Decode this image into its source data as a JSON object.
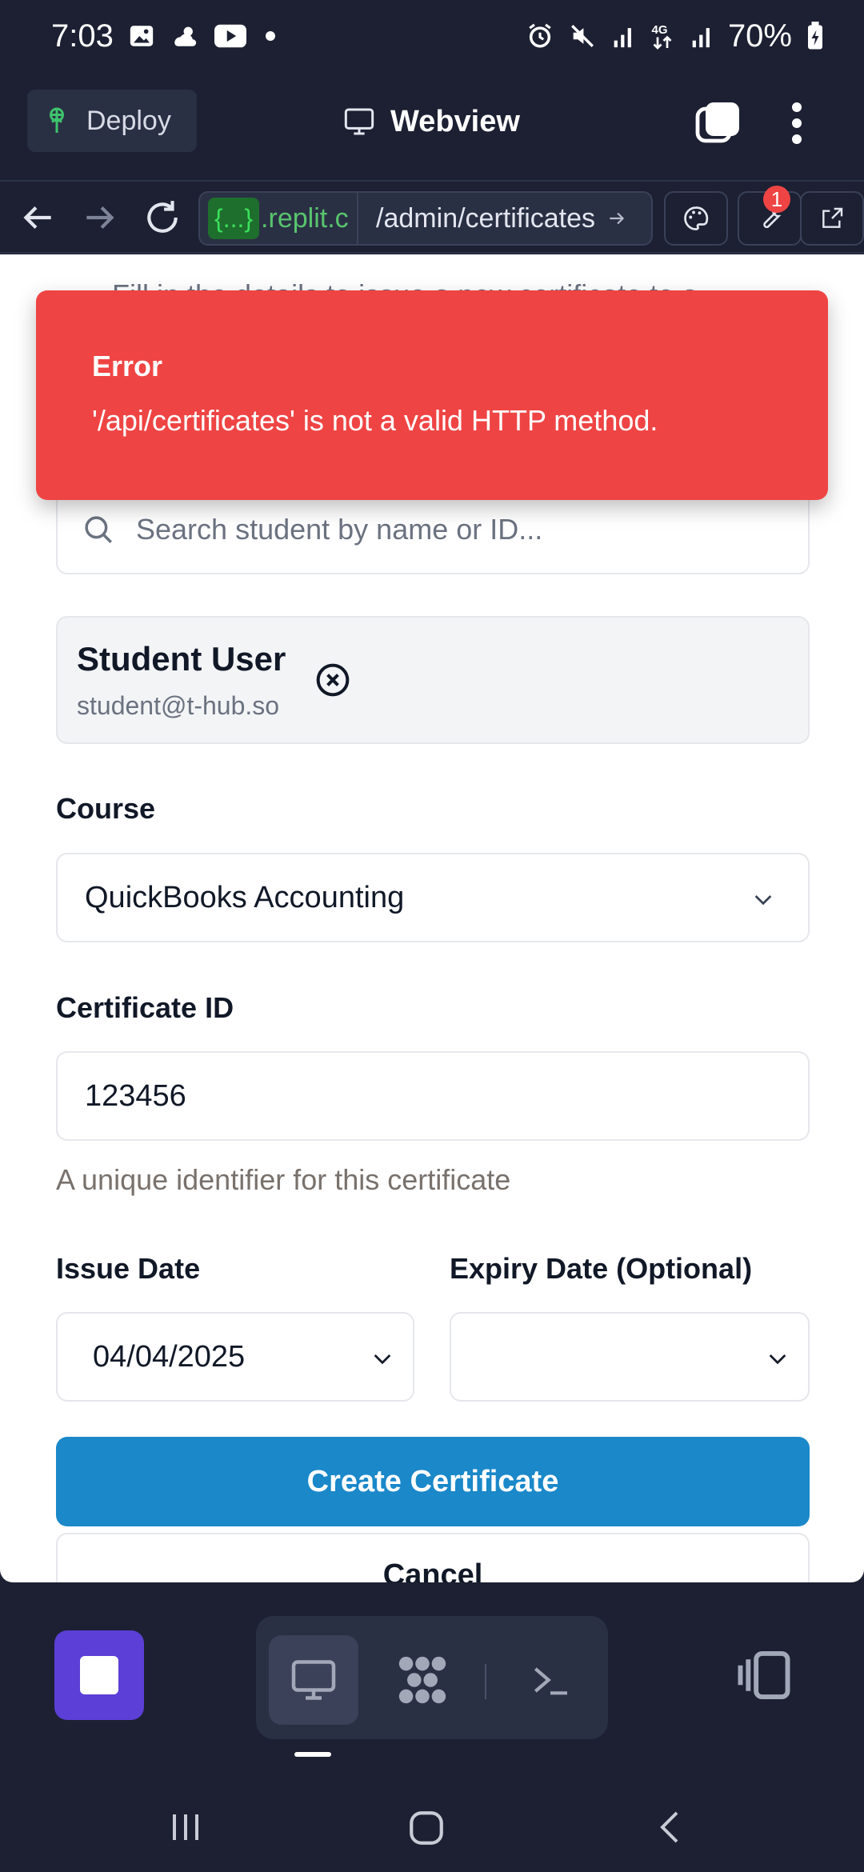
{
  "status_bar": {
    "time": "7:03",
    "battery": "70%"
  },
  "app_bar": {
    "deploy_label": "Deploy",
    "title": "Webview"
  },
  "url_bar": {
    "tag": "{...}",
    "domain": ".replit.c",
    "path": "/admin/certificates",
    "notification_count": "1"
  },
  "page": {
    "behind_text": "Fill in the details to issue a new certificate to a",
    "search_placeholder": "Search student by name or ID...",
    "selected_student": {
      "name": "Student User",
      "email": "student@t-hub.so"
    },
    "course_label": "Course",
    "course_value": "QuickBooks Accounting",
    "certificate_id_label": "Certificate ID",
    "certificate_id_value": "123456",
    "certificate_id_hint": "A unique identifier for this certificate",
    "issue_date_label": "Issue Date",
    "issue_date_value": "04/04/2025",
    "expiry_date_label": "Expiry Date (Optional)",
    "expiry_date_value": "",
    "create_button": "Create Certificate",
    "cancel_button": "Cancel"
  },
  "toast": {
    "title": "Error",
    "message": "'/api/certificates' is not a valid HTTP method."
  },
  "colors": {
    "error": "#ef4444",
    "primary": "#1a88c9",
    "stop": "#5b3fd6",
    "chrome": "#1c2032"
  }
}
